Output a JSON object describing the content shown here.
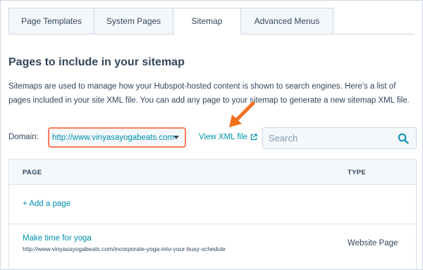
{
  "tabs": [
    {
      "label": "Page Templates",
      "active": false
    },
    {
      "label": "System Pages",
      "active": false
    },
    {
      "label": "Sitemap",
      "active": true
    },
    {
      "label": "Advanced Menus",
      "active": false
    }
  ],
  "main": {
    "heading": "Pages to include in your sitemap",
    "description": "Sitemaps are used to manage how your Hubspot-hosted content is shown to search engines. Here's a list of pages included in your site XML file. You can add any page to your sitemap to generate a new sitemap XML file."
  },
  "domain": {
    "label": "Domain:",
    "selected": "http://www.vinyasayogabeats.com",
    "caret_icon": "chevron-down-icon"
  },
  "xml_link": {
    "label": "View XML file",
    "icon": "external-link-icon"
  },
  "search": {
    "placeholder": "Search",
    "value": "",
    "icon": "search-icon"
  },
  "table": {
    "columns": [
      "PAGE",
      "TYPE"
    ],
    "add_label": "+ Add a page",
    "rows": [
      {
        "title": "Make time for yoga",
        "url": "http://www.vinyasayogabeats.com/incorporate-yoga-into-your-busy-schedule",
        "type": "Website Page"
      }
    ]
  },
  "colors": {
    "accent": "#0091ae",
    "highlight": "#ff7a59",
    "text": "#33475b",
    "border": "#cbd6e2"
  }
}
